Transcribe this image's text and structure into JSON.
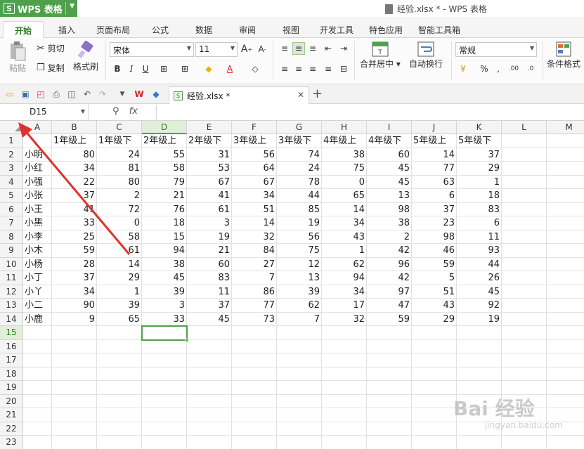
{
  "app": {
    "name": "WPS 表格",
    "window_title": "经验.xlsx * - WPS 表格"
  },
  "menu_tabs": [
    {
      "label": "开始",
      "active": true
    },
    {
      "label": "插入"
    },
    {
      "label": "页面布局"
    },
    {
      "label": "公式"
    },
    {
      "label": "数据"
    },
    {
      "label": "审阅"
    },
    {
      "label": "视图"
    },
    {
      "label": "开发工具"
    },
    {
      "label": "特色应用"
    },
    {
      "label": "智能工具箱"
    }
  ],
  "ribbon": {
    "paste": "粘贴",
    "cut": "剪切",
    "copy": "复制",
    "format_painter": "格式刷",
    "font_name": "宋体",
    "font_size": "11",
    "merge_center": "合并居中",
    "wrap_text": "自动换行",
    "number_format": "常规",
    "conditional_format": "条件格式"
  },
  "document_tab": {
    "label": "经验.xlsx *"
  },
  "formula_bar": {
    "name_box": "D15",
    "fx": "fx",
    "content": ""
  },
  "columns": [
    "A",
    "B",
    "C",
    "D",
    "E",
    "F",
    "G",
    "H",
    "I",
    "J",
    "K",
    "L",
    "M"
  ],
  "selected_cell": {
    "col": "D",
    "row": 15
  },
  "table": {
    "headers": [
      "",
      "1年级上",
      "1年级下",
      "2年级上",
      "2年级下",
      "3年级上",
      "3年级下",
      "4年级上",
      "4年级下",
      "5年级上",
      "5年级下"
    ],
    "rows": [
      [
        "小明",
        80,
        24,
        55,
        31,
        56,
        74,
        38,
        60,
        14,
        37
      ],
      [
        "小红",
        34,
        81,
        58,
        53,
        64,
        24,
        75,
        45,
        77,
        29
      ],
      [
        "小强",
        22,
        80,
        79,
        67,
        67,
        78,
        0,
        45,
        63,
        1
      ],
      [
        "小张",
        37,
        2,
        21,
        41,
        34,
        44,
        65,
        13,
        6,
        18
      ],
      [
        "小王",
        41,
        72,
        76,
        61,
        51,
        85,
        14,
        98,
        37,
        83
      ],
      [
        "小黑",
        33,
        0,
        18,
        3,
        14,
        19,
        34,
        38,
        23,
        6
      ],
      [
        "小李",
        25,
        58,
        15,
        19,
        32,
        56,
        43,
        2,
        98,
        11
      ],
      [
        "小木",
        59,
        61,
        94,
        21,
        84,
        75,
        1,
        42,
        46,
        93
      ],
      [
        "小杨",
        28,
        14,
        38,
        60,
        27,
        12,
        62,
        96,
        59,
        44
      ],
      [
        "小丁",
        37,
        29,
        45,
        83,
        7,
        13,
        94,
        42,
        5,
        26
      ],
      [
        "小丫",
        34,
        1,
        39,
        11,
        86,
        39,
        34,
        97,
        51,
        45
      ],
      [
        "小二",
        90,
        39,
        3,
        37,
        77,
        62,
        17,
        47,
        43,
        92
      ],
      [
        "小鹿",
        9,
        65,
        33,
        45,
        73,
        7,
        32,
        59,
        29,
        19
      ]
    ]
  },
  "watermark": {
    "text": "Bai 经验",
    "sub": "jingyan.baidu.com"
  },
  "colors": {
    "accent": "#4ea14a",
    "annotation_arrow": "#e0322a"
  }
}
